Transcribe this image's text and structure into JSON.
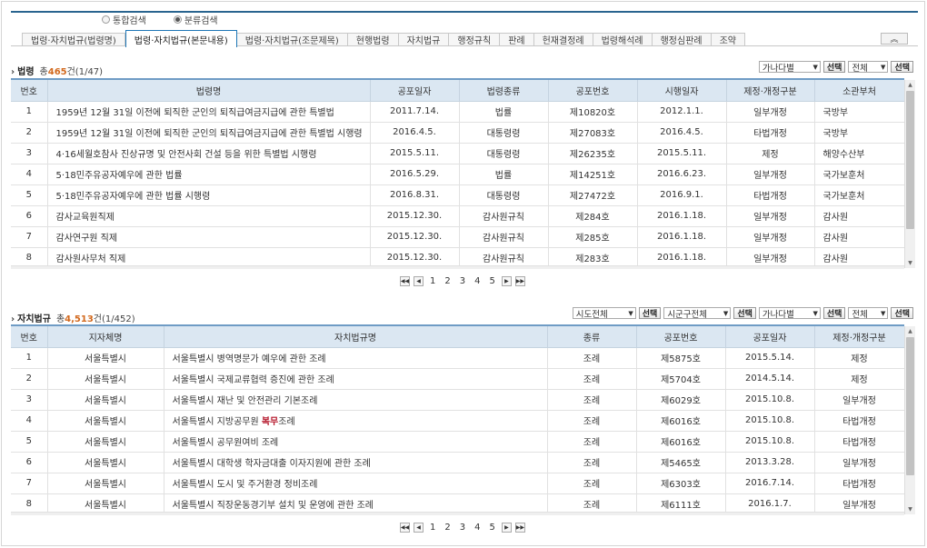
{
  "search_modes": [
    {
      "label": "통합검색",
      "selected": false
    },
    {
      "label": "분류검색",
      "selected": true
    }
  ],
  "tabs": [
    {
      "label": "법령·자치법규(법령명)",
      "active": false
    },
    {
      "label": "법령·자치법규(본문내용)",
      "active": true
    },
    {
      "label": "법령·자치법규(조문제목)",
      "active": false
    },
    {
      "label": "현행법령",
      "active": false
    },
    {
      "label": "자치법규",
      "active": false
    },
    {
      "label": "행정규칙",
      "active": false
    },
    {
      "label": "판례",
      "active": false
    },
    {
      "label": "헌재결정례",
      "active": false
    },
    {
      "label": "법령해석례",
      "active": false
    },
    {
      "label": "행정심판례",
      "active": false
    },
    {
      "label": "조약",
      "active": false
    }
  ],
  "collapse_icon": "double-chevron-up-icon",
  "laws": {
    "title": "법령",
    "total_prefix": "총",
    "count": "465",
    "total_suffix": "건(1/47)",
    "sort_select": "가나다별",
    "filter_select": "전체",
    "select_button": "선택",
    "columns": [
      "번호",
      "법령명",
      "공포일자",
      "법령종류",
      "공포번호",
      "시행일자",
      "제정·개정구분",
      "소관부처"
    ],
    "rows": [
      [
        "1",
        "1959년 12월 31일 이전에 퇴직한 군인의 퇴직급여금지급에 관한 특별법",
        "2011.7.14.",
        "법률",
        "제10820호",
        "2012.1.1.",
        "일부개정",
        "국방부"
      ],
      [
        "2",
        "1959년 12월 31일 이전에 퇴직한 군인의 퇴직급여금지급에 관한 특별법 시행령",
        "2016.4.5.",
        "대통령령",
        "제27083호",
        "2016.4.5.",
        "타법개정",
        "국방부"
      ],
      [
        "3",
        "4·16세월호참사 진상규명 및 안전사회 건설 등을 위한 특별법 시행령",
        "2015.5.11.",
        "대통령령",
        "제26235호",
        "2015.5.11.",
        "제정",
        "해양수산부"
      ],
      [
        "4",
        "5·18민주유공자예우에 관한 법률",
        "2016.5.29.",
        "법률",
        "제14251호",
        "2016.6.23.",
        "일부개정",
        "국가보훈처"
      ],
      [
        "5",
        "5·18민주유공자예우에 관한 법률 시행령",
        "2016.8.31.",
        "대통령령",
        "제27472호",
        "2016.9.1.",
        "타법개정",
        "국가보훈처"
      ],
      [
        "6",
        "감사교육원직제",
        "2015.12.30.",
        "감사원규칙",
        "제284호",
        "2016.1.18.",
        "일부개정",
        "감사원"
      ],
      [
        "7",
        "감사연구원 직제",
        "2015.12.30.",
        "감사원규칙",
        "제285호",
        "2016.1.18.",
        "일부개정",
        "감사원"
      ],
      [
        "8",
        "감사원사무처 직제",
        "2015.12.30.",
        "감사원규칙",
        "제283호",
        "2016.1.18.",
        "일부개정",
        "감사원"
      ]
    ],
    "pages": [
      "1",
      "2",
      "3",
      "4",
      "5"
    ]
  },
  "local": {
    "title": "자치법규",
    "total_prefix": "총",
    "count": "4,513",
    "total_suffix": "건(1/452)",
    "sido_select": "시도전체",
    "sigungu_select": "시군구전체",
    "sort_select": "가나다별",
    "filter_select": "전체",
    "select_button": "선택",
    "columns": [
      "번호",
      "지자체명",
      "자치법규명",
      "종류",
      "공포번호",
      "공포일자",
      "제정·개정구분"
    ],
    "rows": [
      {
        "cells": [
          "1",
          "서울특별시",
          "서울특별시 병역명문가 예우에 관한 조례",
          "조례",
          "제5875호",
          "2015.5.14.",
          "제정"
        ]
      },
      {
        "cells": [
          "2",
          "서울특별시",
          "서울특별시 국제교류협력 증진에 관한 조례",
          "조례",
          "제5704호",
          "2014.5.14.",
          "제정"
        ]
      },
      {
        "cells": [
          "3",
          "서울특별시",
          "서울특별시 재난 및 안전관리 기본조례",
          "조례",
          "제6029호",
          "2015.10.8.",
          "일부개정"
        ]
      },
      {
        "cells": [
          "4",
          "서울특별시",
          "서울특별시 지방공무원 ",
          "조례",
          "제6016호",
          "2015.10.8.",
          "타법개정"
        ],
        "em": "복무",
        "after": "조례"
      },
      {
        "cells": [
          "5",
          "서울특별시",
          "서울특별시 공무원여비 조례",
          "조례",
          "제6016호",
          "2015.10.8.",
          "타법개정"
        ]
      },
      {
        "cells": [
          "6",
          "서울특별시",
          "서울특별시 대학생 학자금대출 이자지원에 관한 조례",
          "조례",
          "제5465호",
          "2013.3.28.",
          "일부개정"
        ]
      },
      {
        "cells": [
          "7",
          "서울특별시",
          "서울특별시 도시 및 주거환경 정비조례",
          "조례",
          "제6303호",
          "2016.7.14.",
          "타법개정"
        ]
      },
      {
        "cells": [
          "8",
          "서울특별시",
          "서울특별시 직장운동경기부 설치 및 운영에 관한 조례",
          "조례",
          "제6111호",
          "2016.1.7.",
          "일부개정"
        ]
      }
    ],
    "pages": [
      "1",
      "2",
      "3",
      "4",
      "5"
    ]
  },
  "pager_icons": [
    "first-page-icon",
    "prev-page-icon",
    "next-page-icon",
    "last-page-icon"
  ]
}
